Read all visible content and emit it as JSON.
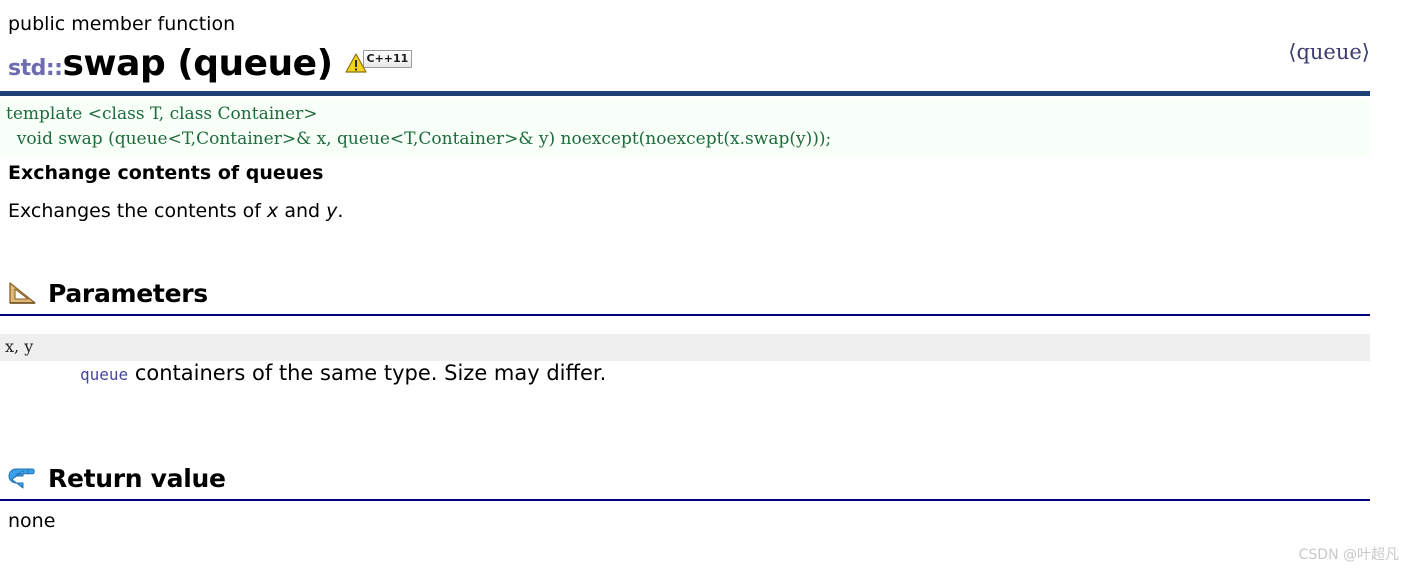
{
  "page": {
    "kind_line": "public member function",
    "header_include": "⟨queue⟩",
    "watermark": "CSDN @叶超凡"
  },
  "title": {
    "namespace": "std::",
    "name": "swap (queue)",
    "warning_icon": "warning-triangle-icon",
    "standard_badge": "C++11"
  },
  "prototype": {
    "line1": "template <class T, class Container>",
    "line2": "  void swap (queue<T,Container>& x, queue<T,Container>& y) noexcept(noexcept(x.swap(y)));"
  },
  "description": {
    "heading": "Exchange contents of queues",
    "text_before": "Exchanges the contents of ",
    "em1": "x",
    "text_middle": " and ",
    "em2": "y",
    "text_after": "."
  },
  "sections": [
    {
      "id": "parameters",
      "icon": "ruler-triangle-icon",
      "title": "Parameters",
      "rows": [
        {
          "name": "x, y",
          "type_link": "queue",
          "desc": " containers of the same type. Size may differ."
        }
      ]
    },
    {
      "id": "return-value",
      "icon": "return-arrow-icon",
      "title": "Return value",
      "body": "none"
    }
  ],
  "colors": {
    "header_rule": "#1f3f77",
    "section_rule": "#000080",
    "code_text": "#1d6b3c",
    "code_bg": "#f8fff8",
    "namespace_text": "#6c6cae",
    "param_band": "#efefef",
    "type_link": "#4646a0",
    "watermark": "#c9c9c9"
  }
}
